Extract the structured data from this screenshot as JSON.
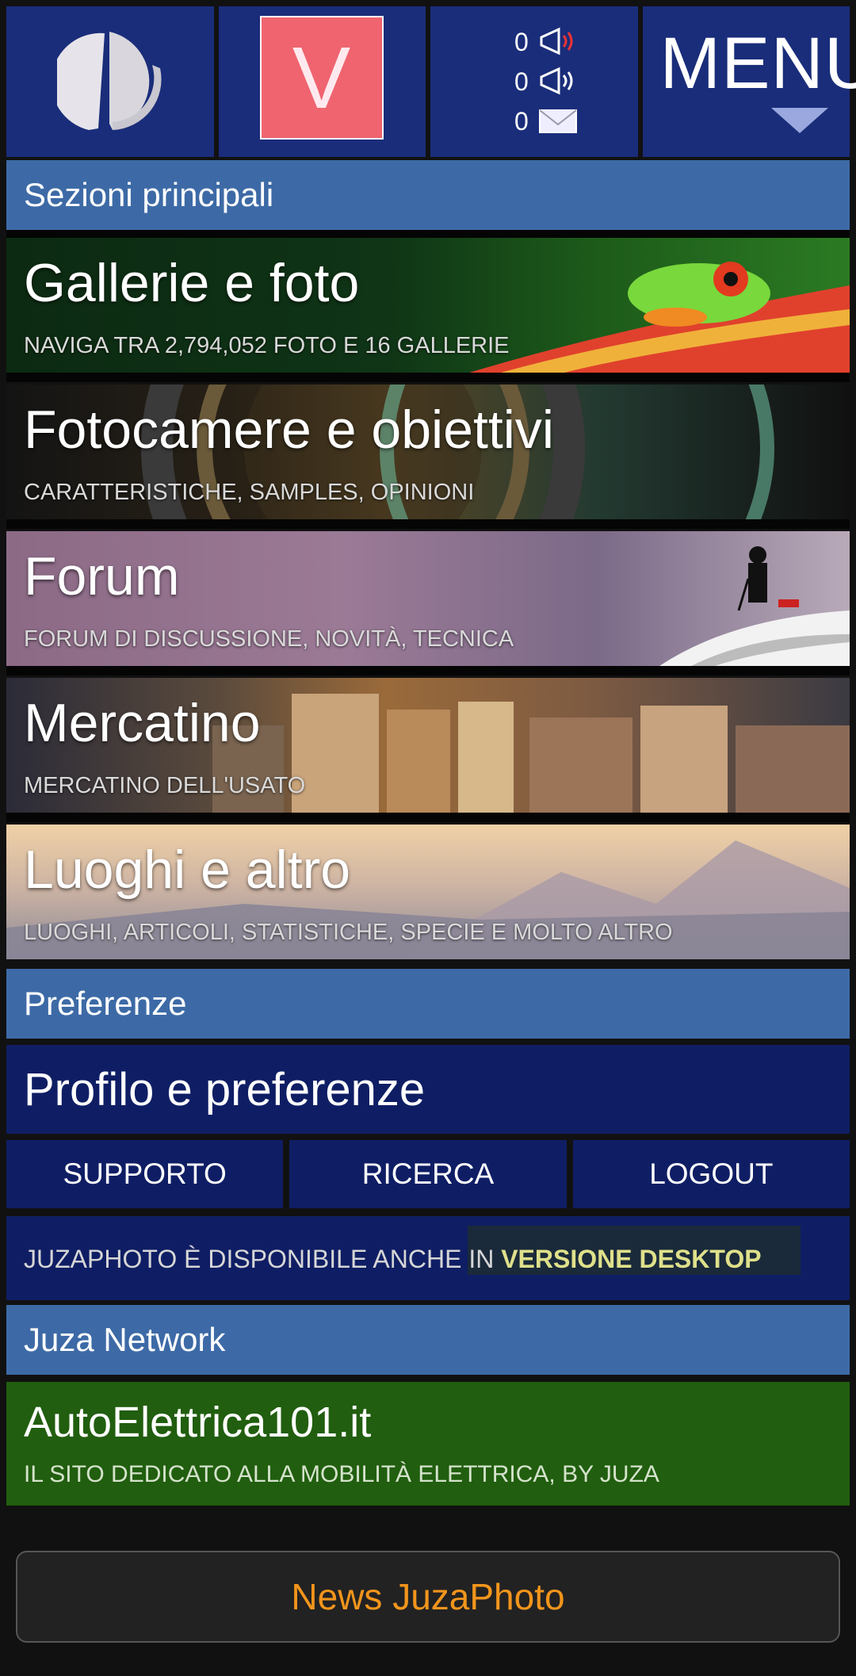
{
  "header": {
    "menu_label": "MENU",
    "badge_letter": "V",
    "notifications": [
      {
        "count": "0",
        "icon": "megaphone-red-icon"
      },
      {
        "count": "0",
        "icon": "megaphone-icon"
      },
      {
        "count": "0",
        "icon": "envelope-icon"
      }
    ]
  },
  "sections": {
    "main": "Sezioni principali",
    "prefs": "Preferenze",
    "network": "Juza Network"
  },
  "tiles": [
    {
      "title": "Gallerie e foto",
      "subtitle": "NAVIGA TRA 2,794,052 FOTO E 16 GALLERIE"
    },
    {
      "title": "Fotocamere e obiettivi",
      "subtitle": "CARATTERISTICHE, SAMPLES, OPINIONI"
    },
    {
      "title": "Forum",
      "subtitle": "FORUM DI DISCUSSIONE, NOVITÀ, TECNICA"
    },
    {
      "title": "Mercatino",
      "subtitle": "MERCATINO DELL'USATO"
    },
    {
      "title": "Luoghi e altro",
      "subtitle": "LUOGHI, ARTICOLI, STATISTICHE, SPECIE E MOLTO ALTRO"
    }
  ],
  "profile": {
    "label": "Profilo e preferenze"
  },
  "buttons": {
    "support": "SUPPORTO",
    "search": "RICERCA",
    "logout": "LOGOUT"
  },
  "desktop": {
    "text": "JUZAPHOTO È DISPONIBILE ANCHE IN ",
    "link": "VERSIONE DESKTOP"
  },
  "network_site": {
    "title": "AutoElettrica101.it",
    "subtitle": "IL SITO DEDICATO ALLA MOBILITÀ ELETTRICA, BY JUZA"
  },
  "news": {
    "label": "News JuzaPhoto"
  },
  "colors": {
    "header_bg": "#1a2d7a",
    "section_bg": "#3d6aa6",
    "dark_row": "#0f1e64",
    "network_bg": "#215e0f",
    "news_text": "#f2951c",
    "badge": "#ef646f"
  }
}
